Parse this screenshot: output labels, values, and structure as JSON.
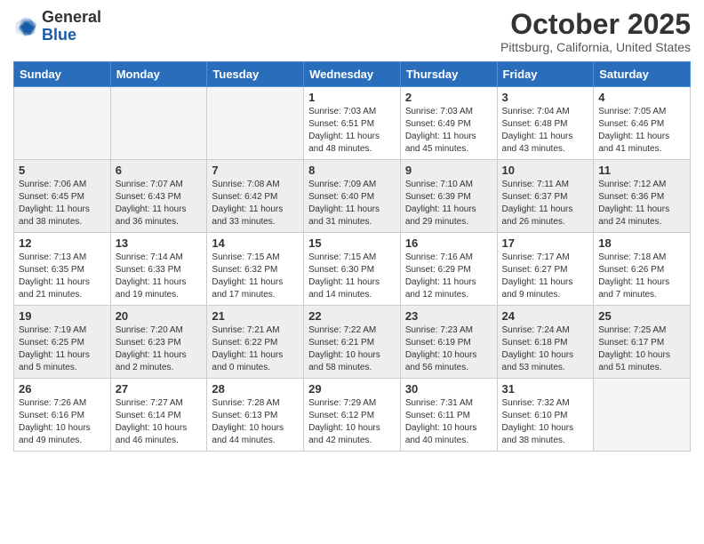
{
  "logo": {
    "general": "General",
    "blue": "Blue"
  },
  "header": {
    "title": "October 2025",
    "subtitle": "Pittsburg, California, United States"
  },
  "days_of_week": [
    "Sunday",
    "Monday",
    "Tuesday",
    "Wednesday",
    "Thursday",
    "Friday",
    "Saturday"
  ],
  "weeks": [
    [
      {
        "day": "",
        "info": ""
      },
      {
        "day": "",
        "info": ""
      },
      {
        "day": "",
        "info": ""
      },
      {
        "day": "1",
        "info": "Sunrise: 7:03 AM\nSunset: 6:51 PM\nDaylight: 11 hours\nand 48 minutes."
      },
      {
        "day": "2",
        "info": "Sunrise: 7:03 AM\nSunset: 6:49 PM\nDaylight: 11 hours\nand 45 minutes."
      },
      {
        "day": "3",
        "info": "Sunrise: 7:04 AM\nSunset: 6:48 PM\nDaylight: 11 hours\nand 43 minutes."
      },
      {
        "day": "4",
        "info": "Sunrise: 7:05 AM\nSunset: 6:46 PM\nDaylight: 11 hours\nand 41 minutes."
      }
    ],
    [
      {
        "day": "5",
        "info": "Sunrise: 7:06 AM\nSunset: 6:45 PM\nDaylight: 11 hours\nand 38 minutes."
      },
      {
        "day": "6",
        "info": "Sunrise: 7:07 AM\nSunset: 6:43 PM\nDaylight: 11 hours\nand 36 minutes."
      },
      {
        "day": "7",
        "info": "Sunrise: 7:08 AM\nSunset: 6:42 PM\nDaylight: 11 hours\nand 33 minutes."
      },
      {
        "day": "8",
        "info": "Sunrise: 7:09 AM\nSunset: 6:40 PM\nDaylight: 11 hours\nand 31 minutes."
      },
      {
        "day": "9",
        "info": "Sunrise: 7:10 AM\nSunset: 6:39 PM\nDaylight: 11 hours\nand 29 minutes."
      },
      {
        "day": "10",
        "info": "Sunrise: 7:11 AM\nSunset: 6:37 PM\nDaylight: 11 hours\nand 26 minutes."
      },
      {
        "day": "11",
        "info": "Sunrise: 7:12 AM\nSunset: 6:36 PM\nDaylight: 11 hours\nand 24 minutes."
      }
    ],
    [
      {
        "day": "12",
        "info": "Sunrise: 7:13 AM\nSunset: 6:35 PM\nDaylight: 11 hours\nand 21 minutes."
      },
      {
        "day": "13",
        "info": "Sunrise: 7:14 AM\nSunset: 6:33 PM\nDaylight: 11 hours\nand 19 minutes."
      },
      {
        "day": "14",
        "info": "Sunrise: 7:15 AM\nSunset: 6:32 PM\nDaylight: 11 hours\nand 17 minutes."
      },
      {
        "day": "15",
        "info": "Sunrise: 7:15 AM\nSunset: 6:30 PM\nDaylight: 11 hours\nand 14 minutes."
      },
      {
        "day": "16",
        "info": "Sunrise: 7:16 AM\nSunset: 6:29 PM\nDaylight: 11 hours\nand 12 minutes."
      },
      {
        "day": "17",
        "info": "Sunrise: 7:17 AM\nSunset: 6:27 PM\nDaylight: 11 hours\nand 9 minutes."
      },
      {
        "day": "18",
        "info": "Sunrise: 7:18 AM\nSunset: 6:26 PM\nDaylight: 11 hours\nand 7 minutes."
      }
    ],
    [
      {
        "day": "19",
        "info": "Sunrise: 7:19 AM\nSunset: 6:25 PM\nDaylight: 11 hours\nand 5 minutes."
      },
      {
        "day": "20",
        "info": "Sunrise: 7:20 AM\nSunset: 6:23 PM\nDaylight: 11 hours\nand 2 minutes."
      },
      {
        "day": "21",
        "info": "Sunrise: 7:21 AM\nSunset: 6:22 PM\nDaylight: 11 hours\nand 0 minutes."
      },
      {
        "day": "22",
        "info": "Sunrise: 7:22 AM\nSunset: 6:21 PM\nDaylight: 10 hours\nand 58 minutes."
      },
      {
        "day": "23",
        "info": "Sunrise: 7:23 AM\nSunset: 6:19 PM\nDaylight: 10 hours\nand 56 minutes."
      },
      {
        "day": "24",
        "info": "Sunrise: 7:24 AM\nSunset: 6:18 PM\nDaylight: 10 hours\nand 53 minutes."
      },
      {
        "day": "25",
        "info": "Sunrise: 7:25 AM\nSunset: 6:17 PM\nDaylight: 10 hours\nand 51 minutes."
      }
    ],
    [
      {
        "day": "26",
        "info": "Sunrise: 7:26 AM\nSunset: 6:16 PM\nDaylight: 10 hours\nand 49 minutes."
      },
      {
        "day": "27",
        "info": "Sunrise: 7:27 AM\nSunset: 6:14 PM\nDaylight: 10 hours\nand 46 minutes."
      },
      {
        "day": "28",
        "info": "Sunrise: 7:28 AM\nSunset: 6:13 PM\nDaylight: 10 hours\nand 44 minutes."
      },
      {
        "day": "29",
        "info": "Sunrise: 7:29 AM\nSunset: 6:12 PM\nDaylight: 10 hours\nand 42 minutes."
      },
      {
        "day": "30",
        "info": "Sunrise: 7:31 AM\nSunset: 6:11 PM\nDaylight: 10 hours\nand 40 minutes."
      },
      {
        "day": "31",
        "info": "Sunrise: 7:32 AM\nSunset: 6:10 PM\nDaylight: 10 hours\nand 38 minutes."
      },
      {
        "day": "",
        "info": ""
      }
    ]
  ]
}
